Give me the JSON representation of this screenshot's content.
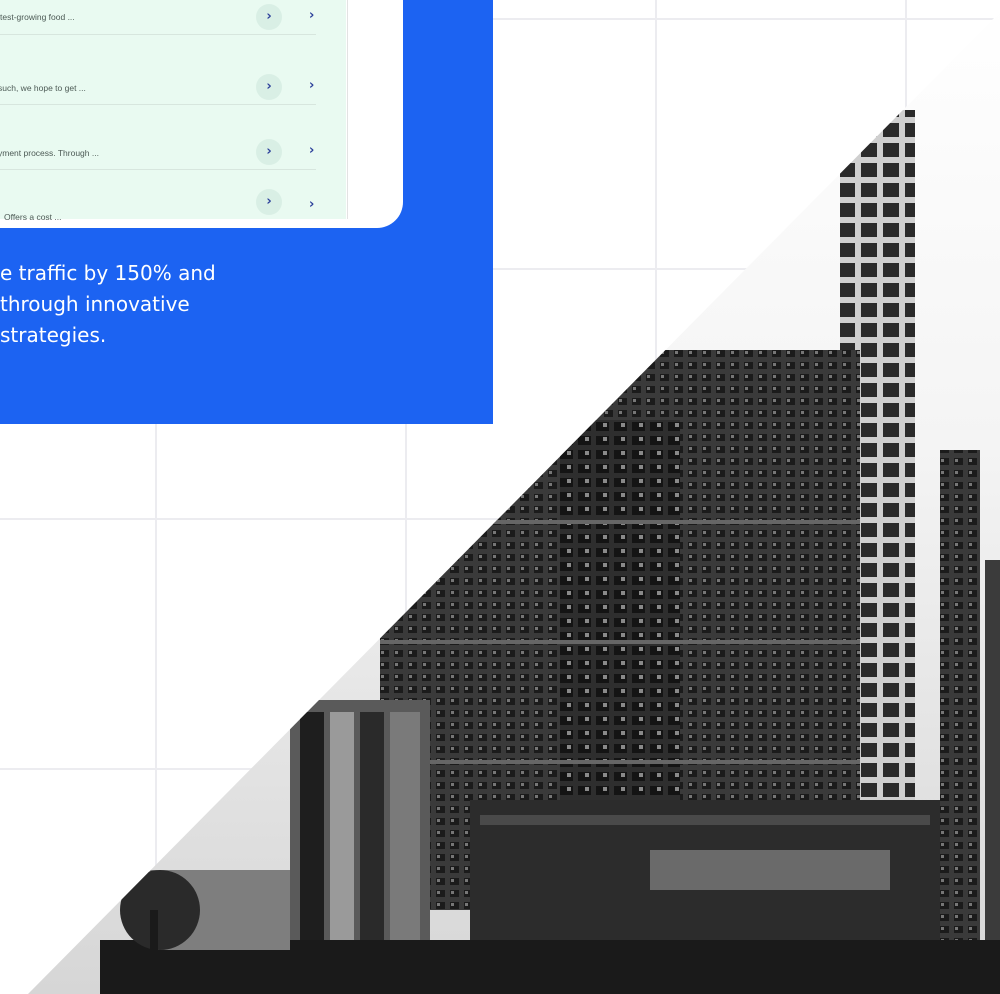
{
  "screenshot_rows": [
    {
      "text": "test-growing food ...",
      "button": "›",
      "chevron": "›"
    },
    {
      "text": "such, we hope to get ...",
      "button": "›",
      "chevron": "›"
    },
    {
      "text": "yment process. Through ...",
      "button": "›",
      "chevron": "›"
    },
    {
      "text": "Offers a cost ...",
      "button": "›",
      "chevron": "›"
    }
  ],
  "description": "e traffic by 150% and\n through innovative\nstrategies.",
  "colors": {
    "accent_blue": "#1c63f2",
    "screenshot_bg": "#e9faf1",
    "chevron": "#2b3f9a"
  },
  "image": {
    "subject": "black-and-white city skyline photo",
    "icon": "city-photo"
  }
}
